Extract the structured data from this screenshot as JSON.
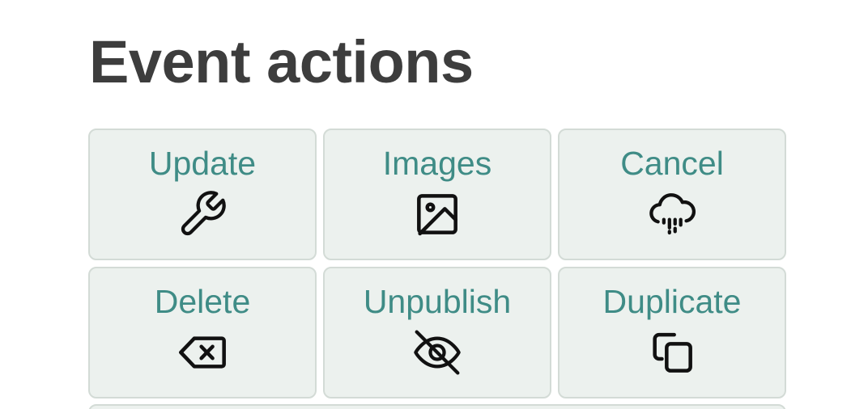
{
  "page": {
    "title": "Event actions"
  },
  "actions": [
    {
      "label": "Update",
      "icon": "wrench-icon"
    },
    {
      "label": "Images",
      "icon": "image-icon"
    },
    {
      "label": "Cancel",
      "icon": "cloud-rain-icon"
    },
    {
      "label": "Delete",
      "icon": "backspace-icon"
    },
    {
      "label": "Unpublish",
      "icon": "eye-slash-icon"
    },
    {
      "label": "Duplicate",
      "icon": "copy-icon"
    }
  ],
  "colors": {
    "title": "#3d3d3d",
    "label": "#3f8c86",
    "tile_background": "#ecf1ee",
    "tile_border": "#d3dbd6",
    "icon": "#111111"
  }
}
